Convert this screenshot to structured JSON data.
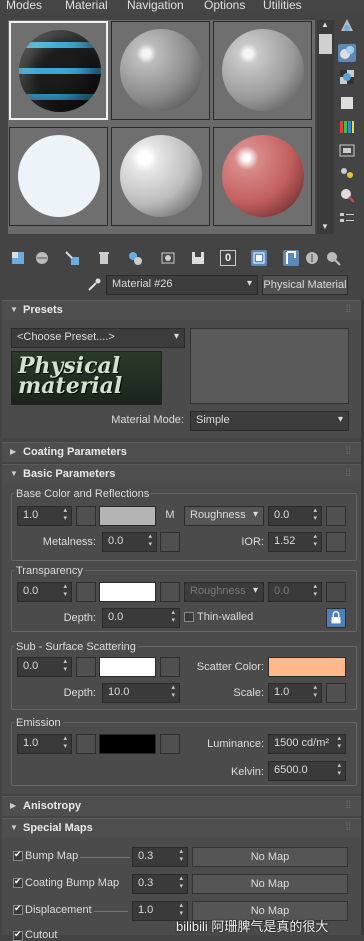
{
  "menu": [
    "Modes",
    "Material",
    "Navigation",
    "Options",
    "Utilities"
  ],
  "material": {
    "name": "Material #26",
    "type_button": "Physical Material"
  },
  "presets": {
    "title": "Presets",
    "choose": "<Choose Preset....>",
    "logo_text": "Physical material",
    "mode_label": "Material Mode:",
    "mode_value": "Simple"
  },
  "rollouts": {
    "coating": "Coating Parameters",
    "basic": "Basic Parameters",
    "anisotropy": "Anisotropy",
    "special": "Special Maps"
  },
  "base": {
    "group": "Base Color and Reflections",
    "weight": "1.0",
    "map_btn": "M",
    "roughness_mode": "Roughness",
    "roughness": "0.0",
    "metalness_label": "Metalness:",
    "metalness": "0.0",
    "ior_label": "IOR:",
    "ior": "1.52",
    "color": "#b4b4b4"
  },
  "transparency": {
    "group": "Transparency",
    "weight": "0.0",
    "roughness_mode": "Roughness",
    "roughness": "0.0",
    "depth_label": "Depth:",
    "depth": "0.0",
    "thin_walled": "Thin-walled",
    "color": "#ffffff"
  },
  "sss": {
    "group": "Sub - Surface Scattering",
    "weight": "0.0",
    "scatter_label": "Scatter Color:",
    "depth_label": "Depth:",
    "depth": "10.0",
    "scale_label": "Scale:",
    "scale": "1.0",
    "color": "#ffffff",
    "scatter_color": "#ffb98a"
  },
  "emission": {
    "group": "Emission",
    "weight": "1.0",
    "luminance_label": "Luminance:",
    "luminance": "1500 cd/m²",
    "kelvin_label": "Kelvin:",
    "kelvin": "6500.0",
    "color": "#000000"
  },
  "special_maps": [
    {
      "label": "Bump Map",
      "value": "0.3",
      "map": "No Map"
    },
    {
      "label": "Coating Bump Map",
      "value": "0.3",
      "map": "No Map"
    },
    {
      "label": "Displacement",
      "value": "1.0",
      "map": "No Map"
    },
    {
      "label": "Cutout",
      "value": "",
      "map": ""
    }
  ],
  "watermark": "bilibili 阿珊脾气是真的很大"
}
